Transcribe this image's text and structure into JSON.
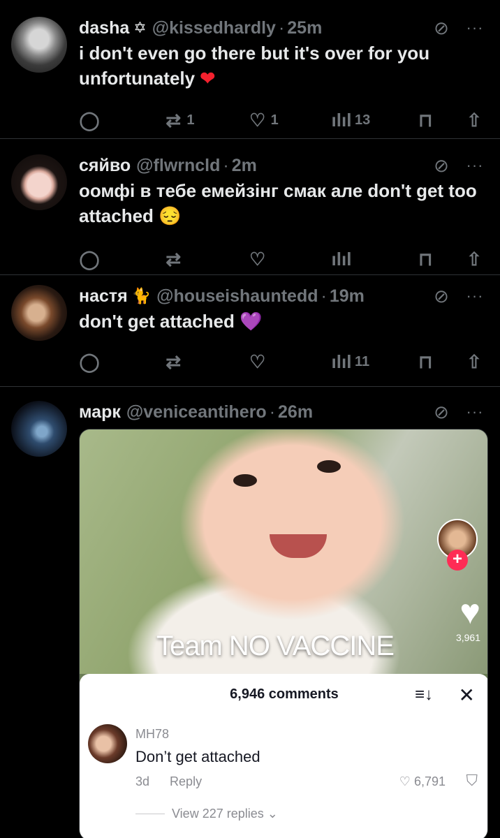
{
  "tweets": [
    {
      "name": "dasha",
      "emoji": "✡",
      "handle": "@kissedhardly",
      "time": "25m",
      "text": "i don't even go there but it's over for you unfortunately",
      "text_emoji": "❤",
      "replies": "",
      "retweets": "1",
      "likes": "1",
      "views": "13"
    },
    {
      "name": "сяйво",
      "emoji": "",
      "handle": "@flwrncld",
      "time": "2m",
      "text": "оомфі в тебе емейзінг смак але don't get too attached",
      "text_emoji": "😔",
      "replies": "",
      "retweets": "",
      "likes": "",
      "views": ""
    },
    {
      "name": "настя",
      "emoji": "🐈",
      "handle": "@houseishauntedd",
      "time": "19m",
      "text": "don't get attached",
      "text_emoji": "💜",
      "replies": "",
      "retweets": "",
      "likes": "",
      "views": "11"
    },
    {
      "name": "марк",
      "emoji": "",
      "handle": "@veniceantihero",
      "time": "26m"
    }
  ],
  "media": {
    "overlay_text": "Team NO VACCINE",
    "like_count": "3,961",
    "sheet_title": "6,946 comments",
    "comment_user": "MH78",
    "comment_text": "Don’t get attached",
    "comment_age": "3d",
    "comment_reply": "Reply",
    "comment_likes": "6,791",
    "view_replies": "View 227 replies ⌄"
  },
  "icons": {
    "grok": "⊘",
    "more": "···",
    "reply": "◯",
    "retweet": "⇄",
    "like": "♡",
    "views": "ılıl",
    "bookmark": "⊓",
    "share": "⇧",
    "sort": "≡↓",
    "close": "✕",
    "heart": "♥",
    "plus": "+",
    "dislike": "⛉"
  }
}
